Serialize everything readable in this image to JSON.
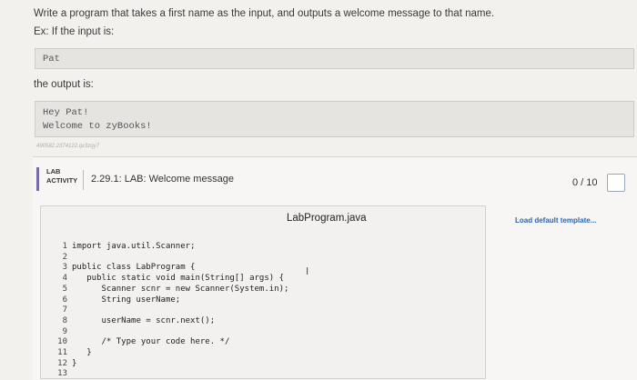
{
  "prompt": {
    "line1": "Write a program that takes a first name as the input, and outputs a welcome message to that name.",
    "line2": "Ex: If the input is:"
  },
  "input_example": {
    "text": "Pat"
  },
  "output_label": "the output is:",
  "output_example": {
    "line1": "Hey Pat!",
    "line2": "Welcome to zyBooks!"
  },
  "hash_text": "490582.2374122.qx3zqy7",
  "lab": {
    "badge_line1": "LAB",
    "badge_line2": "ACTIVITY",
    "title": "2.29.1: LAB: Welcome message",
    "score": "0 / 10"
  },
  "editor": {
    "filename": "LabProgram.java",
    "load_template": "Load default template...",
    "line_numbers": [
      "1",
      "2",
      "3",
      "4",
      "5",
      "6",
      "7",
      "8",
      "9",
      "10",
      "11",
      "12",
      "13"
    ],
    "code": [
      "import java.util.Scanner;",
      "",
      "public class LabProgram {",
      "   public static void main(String[] args) {",
      "      Scanner scnr = new Scanner(System.in);",
      "      String userName;",
      "",
      "      userName = scnr.next();",
      "",
      "      /* Type your code here. */",
      "   }",
      "}",
      ""
    ],
    "cursor_glyph": "I"
  }
}
